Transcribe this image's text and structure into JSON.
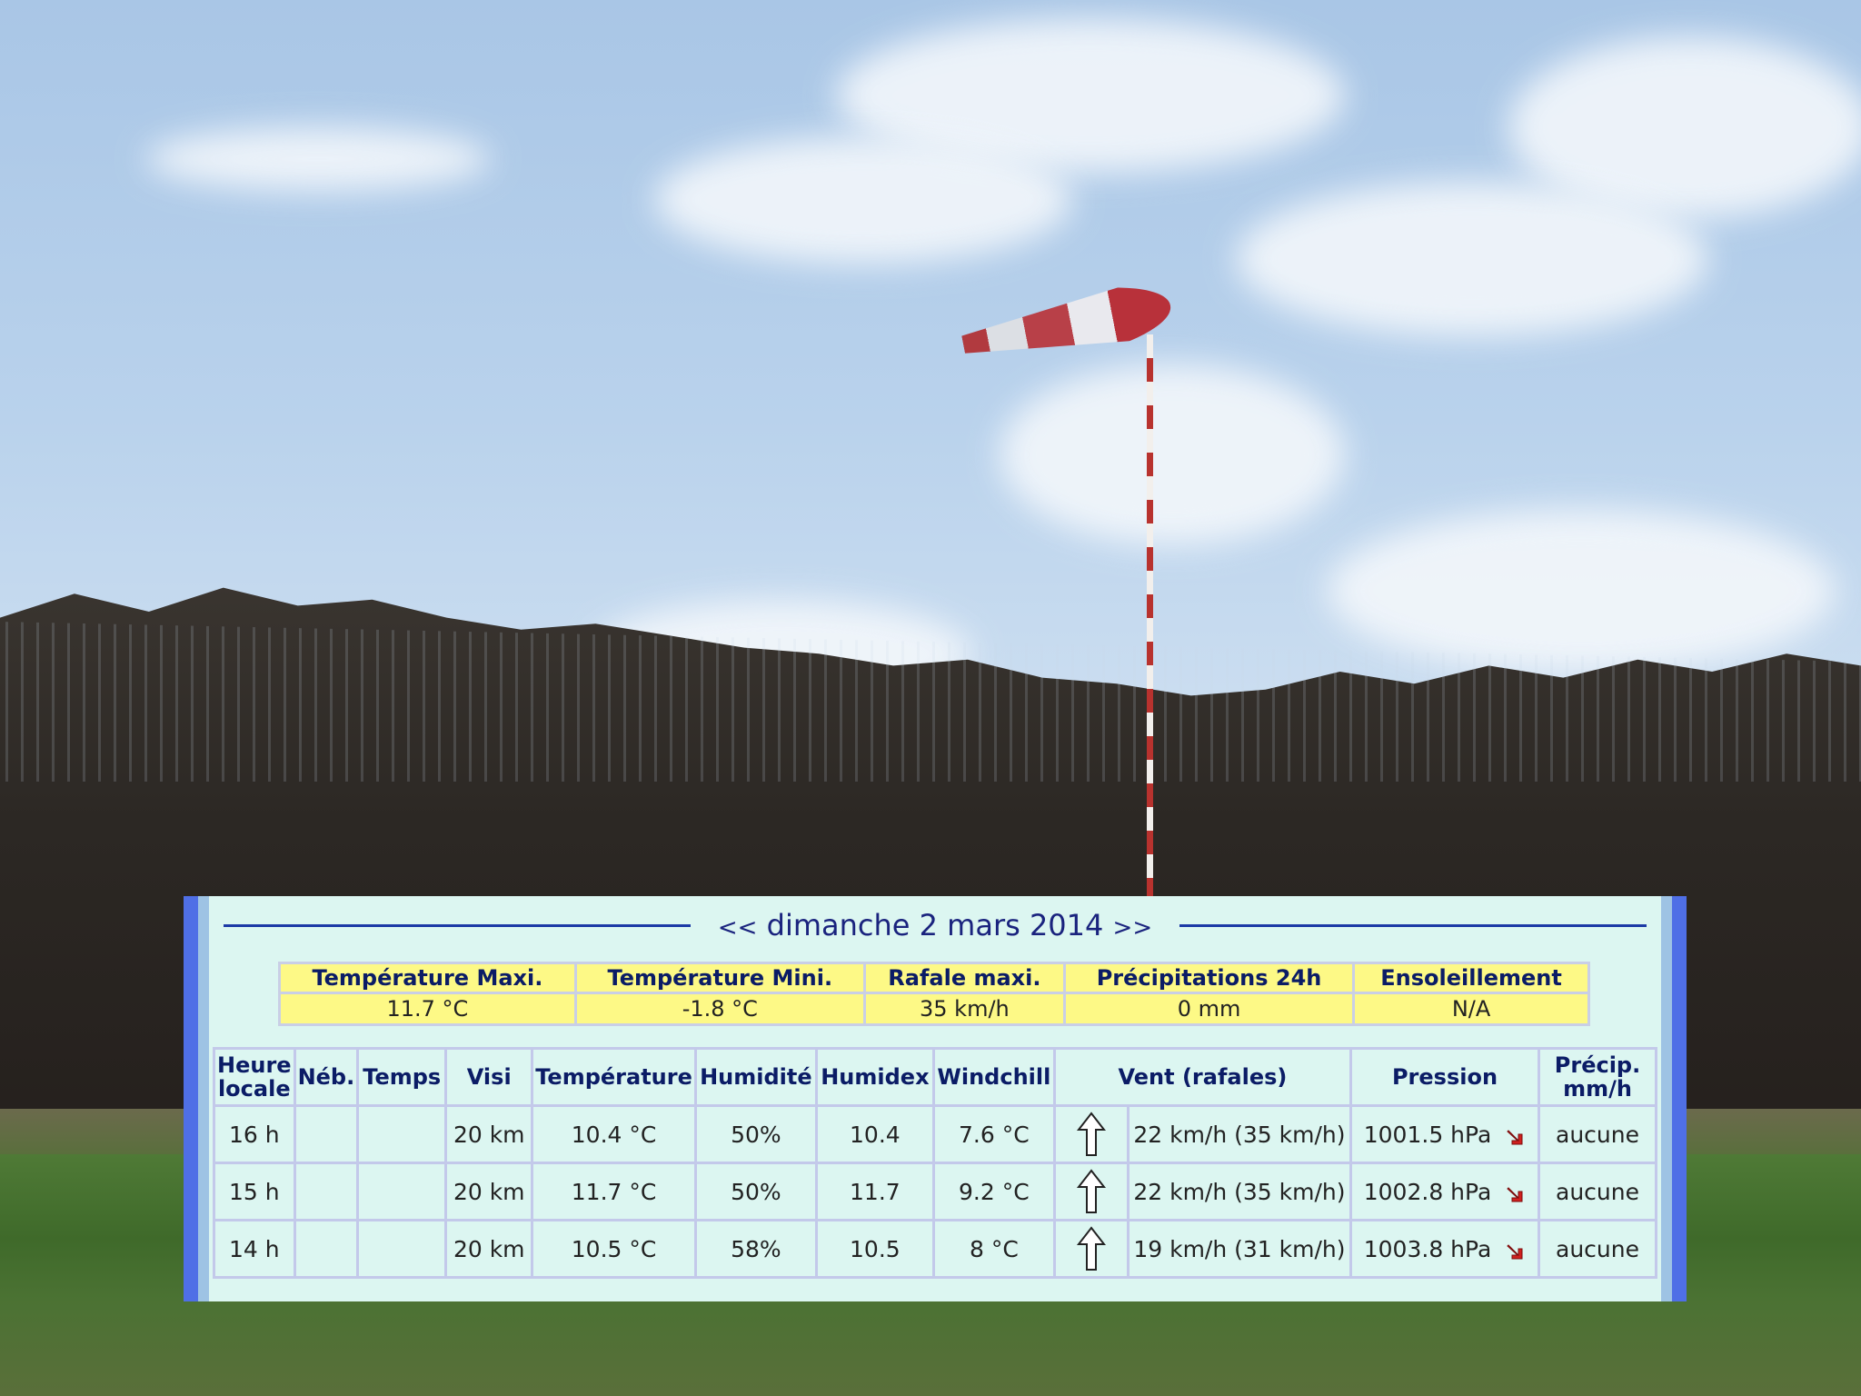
{
  "panel": {
    "title": "dimanche 2 mars 2014",
    "prev": "<<",
    "next": ">>"
  },
  "summary": {
    "headers": [
      "Température Maxi.",
      "Température Mini.",
      "Rafale maxi.",
      "Précipitations 24h",
      "Ensoleillement"
    ],
    "values": [
      "11.7 °C",
      "-1.8 °C",
      "35 km/h",
      "0 mm",
      "N/A"
    ]
  },
  "observations": {
    "headers": {
      "heure": "Heure locale",
      "neb": "Néb.",
      "temps": "Temps",
      "visi": "Visi",
      "temperature": "Température",
      "humidite": "Humidité",
      "humidex": "Humidex",
      "windchill": "Windchill",
      "vent": "Vent (rafales)",
      "pression": "Pression",
      "precip": "Précip. mm/h"
    },
    "rows": [
      {
        "heure": "16 h",
        "neb": "",
        "temps": "",
        "visi": "20 km",
        "temperature": "10.4 °C",
        "humidite": "50%",
        "humidex": "10.4",
        "windchill": "7.6 °C",
        "vent": "22 km/h (35 km/h)",
        "pression": "1001.5 hPa",
        "precip": "aucune"
      },
      {
        "heure": "15 h",
        "neb": "",
        "temps": "",
        "visi": "20 km",
        "temperature": "11.7 °C",
        "humidite": "50%",
        "humidex": "11.7",
        "windchill": "9.2 °C",
        "vent": "22 km/h (35 km/h)",
        "pression": "1002.8 hPa",
        "precip": "aucune"
      },
      {
        "heure": "14 h",
        "neb": "",
        "temps": "",
        "visi": "20 km",
        "temperature": "10.5 °C",
        "humidite": "58%",
        "humidex": "10.5",
        "windchill": "8 °C",
        "vent": "19 km/h (31 km/h)",
        "pression": "1003.8 hPa",
        "precip": "aucune"
      }
    ]
  },
  "icons": {
    "wind_direction": "arrow-up-icon",
    "pressure_trend": "trend-down-right-icon"
  },
  "colors": {
    "panel_bg": "#dcf6f1",
    "summary_bg": "#fdf986",
    "title_color": "#1a237e",
    "trend_red": "#d0201e"
  }
}
